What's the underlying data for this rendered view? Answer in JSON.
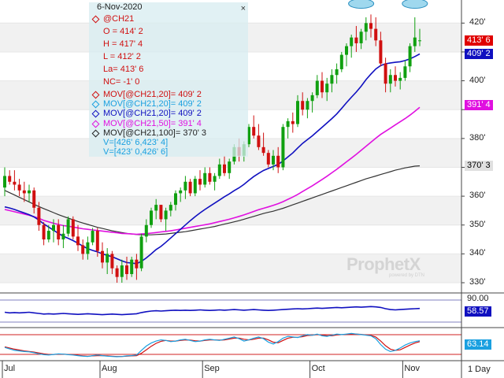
{
  "chart_data": {
    "type": "candlestick",
    "date": "6-Nov-2020",
    "symbol": "@CH21",
    "ohlc_readout": [
      {
        "label": "O = 414' 2",
        "color": "#d01010"
      },
      {
        "label": "H = 417' 4",
        "color": "#d01010"
      },
      {
        "label": "L = 412' 2",
        "color": "#d01010"
      },
      {
        "label": "La= 413' 6",
        "color": "#d01010"
      },
      {
        "label": "NC= -1' 0",
        "color": "#d01010"
      }
    ],
    "studies": [
      {
        "label": "MOV[@CH21,20]= 409' 2",
        "color": "#d01010",
        "marker": "#d01010"
      },
      {
        "label": "MOV[@CH21,20]= 409' 2",
        "color": "#1aa0e0",
        "marker": "#1aa0e0"
      },
      {
        "label": "MOV[@CH21,20]= 409' 2",
        "color": "#1010c0",
        "marker": "#1010c0"
      },
      {
        "label": "MOV[@CH21,50]= 391' 4",
        "color": "#e010e0",
        "marker": "#e010e0"
      },
      {
        "label": "MOV[@CH21,100]= 370' 3",
        "color": "#222222",
        "marker": "#222222"
      },
      {
        "label": "V=[426' 6,423' 4]",
        "color": "#1aa0e0",
        "marker": null
      },
      {
        "label": "V=[423' 0,426' 6]",
        "color": "#1aa0e0",
        "marker": null
      }
    ],
    "y_axis": {
      "ticks": [
        330,
        340,
        350,
        360,
        370,
        380,
        390,
        400,
        410,
        420
      ],
      "tick_labels": [
        "330'",
        "340'",
        "350'",
        "360'",
        "370' 3",
        "380'",
        "391' 4",
        "400'",
        "409' 2",
        "420'"
      ],
      "ylim": [
        327,
        428
      ]
    },
    "price_tags": [
      {
        "label": "413' 6",
        "value": 413.75,
        "bg": "#e00000",
        "fg": "#ffffff"
      },
      {
        "label": "409' 2",
        "value": 409.25,
        "bg": "#1010c0",
        "fg": "#ffffff"
      },
      {
        "label": "391' 4",
        "value": 391.5,
        "bg": "#e010e0",
        "fg": "#ffffff"
      },
      {
        "label": "370' 3",
        "value": 370.375,
        "bg": "#e0e0e0",
        "fg": "#000000"
      }
    ],
    "x_axis": {
      "month_labels": [
        "Jul",
        "Aug",
        "Sep",
        "Oct",
        "Nov"
      ],
      "period": "1 Day"
    },
    "candles_ohlc": [
      [
        363,
        370,
        360,
        367
      ],
      [
        367,
        369,
        364,
        365
      ],
      [
        365,
        369,
        362,
        364
      ],
      [
        364,
        366,
        360,
        362
      ],
      [
        362,
        365,
        358,
        361
      ],
      [
        361,
        364,
        358,
        362
      ],
      [
        362,
        363,
        354,
        356
      ],
      [
        356,
        358,
        348,
        350
      ],
      [
        350,
        351,
        343,
        345
      ],
      [
        345,
        350,
        344,
        348
      ],
      [
        348,
        352,
        344,
        350
      ],
      [
        350,
        352,
        343,
        345
      ],
      [
        345,
        350,
        342,
        347
      ],
      [
        347,
        353,
        346,
        352
      ],
      [
        352,
        353,
        345,
        346
      ],
      [
        346,
        350,
        341,
        343
      ],
      [
        343,
        345,
        338,
        340
      ],
      [
        340,
        346,
        338,
        344
      ],
      [
        344,
        349,
        343,
        348
      ],
      [
        348,
        349,
        339,
        341
      ],
      [
        341,
        344,
        335,
        337
      ],
      [
        337,
        342,
        333,
        340
      ],
      [
        340,
        341,
        333,
        335
      ],
      [
        335,
        336,
        330,
        332
      ],
      [
        332,
        338,
        330,
        336
      ],
      [
        336,
        339,
        331,
        333
      ],
      [
        333,
        339,
        332,
        338
      ],
      [
        338,
        340,
        331,
        335
      ],
      [
        335,
        347,
        334,
        346
      ],
      [
        346,
        352,
        344,
        350
      ],
      [
        350,
        356,
        349,
        355
      ],
      [
        355,
        359,
        352,
        357
      ],
      [
        357,
        357,
        351,
        352
      ],
      [
        352,
        356,
        348,
        355
      ],
      [
        355,
        358,
        353,
        357
      ],
      [
        357,
        362,
        355,
        361
      ],
      [
        361,
        363,
        358,
        362
      ],
      [
        362,
        367,
        359,
        365
      ],
      [
        365,
        366,
        360,
        361
      ],
      [
        361,
        367,
        360,
        366
      ],
      [
        366,
        369,
        362,
        364
      ],
      [
        364,
        370,
        363,
        368
      ],
      [
        368,
        370,
        364,
        365
      ],
      [
        365,
        368,
        362,
        367
      ],
      [
        367,
        373,
        366,
        371
      ],
      [
        371,
        374,
        367,
        368
      ],
      [
        368,
        373,
        366,
        372
      ],
      [
        372,
        378,
        371,
        377
      ],
      [
        377,
        380,
        372,
        374
      ],
      [
        374,
        379,
        372,
        378
      ],
      [
        378,
        385,
        377,
        384
      ],
      [
        384,
        388,
        380,
        381
      ],
      [
        381,
        385,
        376,
        377
      ],
      [
        377,
        382,
        374,
        375
      ],
      [
        375,
        376,
        370,
        371
      ],
      [
        371,
        376,
        369,
        374
      ],
      [
        374,
        377,
        368,
        370
      ],
      [
        370,
        385,
        369,
        384
      ],
      [
        384,
        387,
        380,
        386
      ],
      [
        386,
        389,
        382,
        385
      ],
      [
        385,
        395,
        384,
        393
      ],
      [
        393,
        396,
        388,
        390
      ],
      [
        390,
        394,
        387,
        393
      ],
      [
        393,
        396,
        389,
        395
      ],
      [
        395,
        402,
        394,
        400
      ],
      [
        400,
        403,
        394,
        396
      ],
      [
        396,
        401,
        393,
        399
      ],
      [
        399,
        404,
        396,
        402
      ],
      [
        402,
        406,
        399,
        404
      ],
      [
        404,
        410,
        403,
        409
      ],
      [
        409,
        413,
        405,
        412
      ],
      [
        412,
        416,
        408,
        415
      ],
      [
        415,
        419,
        410,
        413
      ],
      [
        413,
        418,
        411,
        417
      ],
      [
        417,
        422,
        414,
        420
      ],
      [
        420,
        423,
        415,
        418
      ],
      [
        418,
        422,
        412,
        414
      ],
      [
        414,
        417,
        405,
        406
      ],
      [
        406,
        408,
        396,
        399
      ],
      [
        399,
        404,
        396,
        402
      ],
      [
        402,
        405,
        398,
        400
      ],
      [
        400,
        403,
        397,
        401
      ],
      [
        401,
        407,
        400,
        405
      ],
      [
        405,
        413,
        403,
        412
      ],
      [
        412,
        422,
        410,
        415
      ],
      [
        414,
        418,
        412,
        414
      ]
    ],
    "ma20": [
      356.3,
      355.9,
      355.4,
      354.8,
      354.2,
      353.6,
      352.8,
      351.7,
      350.4,
      349.3,
      348.2,
      347.1,
      346.1,
      345.4,
      344.6,
      343.7,
      342.7,
      341.8,
      341.2,
      340.7,
      340.0,
      339.5,
      339.0,
      338.3,
      337.6,
      337.0,
      336.8,
      336.6,
      337.4,
      338.6,
      340.0,
      341.5,
      342.6,
      344.0,
      345.5,
      347.0,
      348.5,
      350.0,
      351.5,
      352.9,
      354.2,
      355.4,
      356.5,
      357.6,
      358.7,
      359.8,
      360.8,
      361.9,
      362.9,
      364.1,
      365.5,
      366.8,
      367.9,
      368.9,
      369.6,
      370.3,
      371.0,
      372.2,
      373.6,
      375.0,
      376.7,
      378.3,
      379.6,
      380.9,
      382.4,
      383.9,
      385.4,
      386.9,
      388.5,
      390.4,
      392.4,
      394.3,
      396.1,
      398.1,
      400.4,
      402.3,
      404.1,
      405.3,
      405.9,
      406.2,
      406.4,
      406.6,
      407.0,
      407.6,
      408.4,
      409.3
    ],
    "ma50": [
      355.4,
      355.0,
      354.6,
      354.2,
      353.8,
      353.4,
      352.9,
      352.3,
      351.6,
      351.1,
      350.6,
      350.2,
      349.8,
      349.6,
      349.3,
      349.0,
      348.7,
      348.5,
      348.3,
      348.1,
      347.9,
      347.7,
      347.5,
      347.3,
      347.1,
      347.0,
      346.9,
      346.8,
      346.9,
      347.0,
      347.2,
      347.4,
      347.6,
      347.8,
      348.0,
      348.3,
      348.6,
      348.9,
      349.2,
      349.5,
      349.8,
      350.1,
      350.4,
      350.8,
      351.2,
      351.6,
      352.0,
      352.5,
      353.0,
      353.5,
      354.1,
      354.7,
      355.3,
      355.8,
      356.3,
      356.8,
      357.4,
      358.1,
      358.9,
      359.7,
      360.6,
      361.6,
      362.6,
      363.6,
      364.7,
      365.8,
      366.9,
      368.1,
      369.3,
      370.6,
      371.9,
      373.2,
      374.5,
      375.9,
      377.3,
      378.7,
      380.1,
      381.4,
      382.5,
      383.6,
      384.7,
      385.8,
      386.9,
      388.1,
      389.4,
      390.8
    ],
    "ma100": [
      362.0,
      361.2,
      360.4,
      359.6,
      358.8,
      358.0,
      357.2,
      356.4,
      355.7,
      355.0,
      354.3,
      353.6,
      353.0,
      352.4,
      351.8,
      351.2,
      350.7,
      350.2,
      349.7,
      349.2,
      348.8,
      348.4,
      348.0,
      347.7,
      347.4,
      347.1,
      346.9,
      346.7,
      346.6,
      346.6,
      346.6,
      346.7,
      346.8,
      346.9,
      347.1,
      347.3,
      347.5,
      347.7,
      348.0,
      348.3,
      348.6,
      348.9,
      349.2,
      349.5,
      349.9,
      350.3,
      350.7,
      351.1,
      351.5,
      352.0,
      352.5,
      353.0,
      353.5,
      354.0,
      354.4,
      354.8,
      355.3,
      355.8,
      356.4,
      357.0,
      357.6,
      358.2,
      358.8,
      359.4,
      360.0,
      360.6,
      361.2,
      361.8,
      362.4,
      363.0,
      363.6,
      364.2,
      364.8,
      365.4,
      366.0,
      366.5,
      367.0,
      367.5,
      368.0,
      368.5,
      369.0,
      369.4,
      369.8,
      370.1,
      370.4,
      370.5
    ],
    "indicator1": {
      "label": "58.57",
      "axis_label": "90.00",
      "bg": "#1010c0",
      "values": [
        46,
        44,
        45,
        44,
        45,
        46,
        44,
        42,
        40,
        41,
        40,
        41,
        42,
        41,
        40,
        39,
        40,
        41,
        40,
        39,
        38,
        39,
        40,
        39,
        38,
        39,
        40,
        41,
        45,
        48,
        50,
        51,
        50,
        51,
        52,
        53,
        52,
        53,
        52,
        53,
        54,
        53,
        52,
        53,
        54,
        53,
        54,
        55,
        54,
        53,
        54,
        55,
        54,
        53,
        52,
        53,
        54,
        55,
        56,
        57,
        58,
        57,
        58,
        59,
        60,
        59,
        60,
        61,
        62,
        61,
        62,
        63,
        64,
        63,
        64,
        65,
        64,
        62,
        58,
        55,
        54,
        55,
        56,
        57,
        58,
        58.57
      ]
    },
    "indicator2": {
      "label": "63.14",
      "bg": "#1aa0e0",
      "k_values": [
        40,
        35,
        30,
        28,
        26,
        25,
        22,
        18,
        15,
        14,
        16,
        18,
        17,
        15,
        14,
        12,
        10,
        9,
        12,
        14,
        12,
        10,
        9,
        8,
        9,
        11,
        12,
        14,
        30,
        45,
        55,
        62,
        66,
        64,
        60,
        62,
        66,
        68,
        64,
        60,
        62,
        66,
        68,
        66,
        64,
        68,
        72,
        76,
        70,
        62,
        66,
        72,
        76,
        70,
        58,
        52,
        60,
        72,
        78,
        76,
        74,
        80,
        84,
        82,
        86,
        80,
        78,
        82,
        86,
        84,
        86,
        88,
        86,
        84,
        82,
        80,
        70,
        50,
        34,
        26,
        30,
        38,
        48,
        55,
        60,
        63
      ],
      "d_values": [
        42,
        38,
        34,
        31,
        28,
        26,
        24,
        21,
        18,
        16,
        16,
        17,
        17,
        16,
        15,
        13,
        11,
        10,
        11,
        12,
        12,
        11,
        10,
        9,
        9,
        10,
        11,
        12,
        20,
        32,
        44,
        54,
        61,
        64,
        62,
        62,
        64,
        66,
        65,
        63,
        62,
        64,
        66,
        66,
        65,
        66,
        69,
        72,
        72,
        68,
        66,
        68,
        72,
        72,
        66,
        58,
        56,
        64,
        72,
        75,
        75,
        77,
        81,
        82,
        84,
        82,
        80,
        80,
        83,
        84,
        85,
        86,
        86,
        85,
        83,
        81,
        76,
        62,
        46,
        34,
        30,
        32,
        40,
        48,
        55,
        60
      ]
    }
  },
  "legend": {
    "close_mark": "×"
  },
  "watermark": {
    "brand": "ProphetX",
    "sub": "powered by DTN"
  }
}
